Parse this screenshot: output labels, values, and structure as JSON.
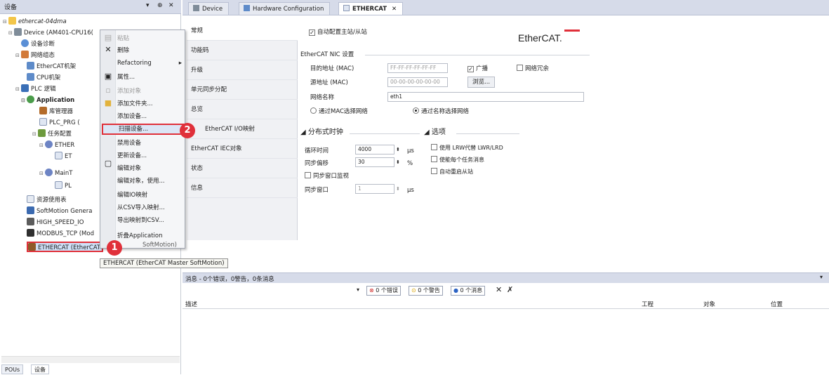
{
  "device_pane": {
    "title": "设备",
    "title_buttons": [
      "▾",
      "⊕",
      "✕"
    ],
    "tree": [
      {
        "label": "ethercat-04dma",
        "icon": "project-icon"
      },
      {
        "label": "Device (AM401-CPU16(",
        "icon": "device-icon"
      },
      {
        "label": "设备诊断",
        "icon": "diagnostics-icon"
      },
      {
        "label": "网络组态",
        "icon": "network-icon"
      },
      {
        "label": "EtherCAT机架",
        "icon": "rack-icon"
      },
      {
        "label": "CPU机架",
        "icon": "rack-icon"
      },
      {
        "label": "PLC 逻辑",
        "icon": "plc-icon"
      },
      {
        "label": "Application",
        "icon": "application-icon"
      },
      {
        "label": "库管理器",
        "icon": "library-icon"
      },
      {
        "label": "PLC_PRG (",
        "icon": "program-icon"
      },
      {
        "label": "任务配置",
        "icon": "task-icon"
      },
      {
        "label": "ETHER",
        "icon": "task-icon"
      },
      {
        "label": "ET",
        "icon": "program-icon"
      },
      {
        "label": "MainT",
        "icon": "task-icon"
      },
      {
        "label": "PL",
        "icon": "program-icon"
      },
      {
        "label": "资源使用表",
        "icon": "resource-icon"
      },
      {
        "label": "SoftMotion Genera",
        "icon": "softmotion-icon"
      },
      {
        "label": "HIGH_SPEED_IO",
        "icon": "io-icon"
      },
      {
        "label": "MODBUS_TCP (Mod",
        "icon": "modbus-icon"
      },
      {
        "label": "ETHERCAT (EtherCAT",
        "icon": "ethercat-icon"
      }
    ],
    "bottom_tabs": [
      "POUs",
      "设备"
    ]
  },
  "context_menu": {
    "items": [
      {
        "label": "粘贴",
        "disabled": true
      },
      {
        "label": "删除",
        "disabled": false
      },
      {
        "label": "Refactoring",
        "disabled": false,
        "submenu": "▸"
      },
      {
        "label": "属性...",
        "disabled": false
      },
      {
        "label": "添加对象",
        "disabled": true
      },
      {
        "label": "添加文件夹...",
        "disabled": false
      },
      {
        "label": "添加设备...",
        "disabled": false
      },
      {
        "label": "扫描设备...",
        "disabled": false
      },
      {
        "label": "禁用设备",
        "disabled": false
      },
      {
        "label": "更新设备...",
        "disabled": false
      },
      {
        "label": "编辑对象",
        "disabled": false
      },
      {
        "label": "编辑对象，使用...",
        "disabled": false
      },
      {
        "label": "编辑IO映射",
        "disabled": false
      },
      {
        "label": "从CSV导入映射...",
        "disabled": false
      },
      {
        "label": "导出映射到CSV...",
        "disabled": false
      },
      {
        "label": "折叠Application",
        "disabled": false
      }
    ],
    "tail_text": "SoftMotion)",
    "tooltip": "ETHERCAT (EtherCAT Master SoftMotion)"
  },
  "badges": [
    "1",
    "2"
  ],
  "editor_tabs": [
    {
      "label": "Device",
      "icon": "device-icon"
    },
    {
      "label": "Hardware Configuration",
      "icon": "hardware-icon"
    },
    {
      "label": "ETHERCAT",
      "icon": "ethercat-icon",
      "close": "✕"
    }
  ],
  "config_nav": [
    "常规",
    "功能码",
    "升级",
    "单元同步分配",
    "总览",
    "EtherCAT I/O映射",
    "EtherCAT IEC对象",
    "状态",
    "信息"
  ],
  "general": {
    "auto_config": "自动配置主站/从站",
    "logo_text": "EtherCAT.",
    "nic_section": "EtherCAT NIC 设置",
    "dest_addr_label": "目的地址 (MAC)",
    "dest_addr_value": "FF-FF-FF-FF-FF-FF",
    "broadcast": "广播",
    "redundancy": "冗余",
    "redundancy_prefix": "网络",
    "src_addr_label": "源地址 (MAC)",
    "src_addr_value": "00-00-00-00-00-00",
    "browse": "浏览...",
    "net_name_label": "网络名称",
    "net_name_value": "eth1",
    "select_by_mac": "通过MAC选择网络",
    "select_by_name": "通过名称选择网络",
    "dc_section": "分布式时钟",
    "options_section": "选项",
    "cycle_label": "循环时间",
    "cycle_value": "4000",
    "cycle_unit": "μs",
    "sync_offset_label": "同步偏移",
    "sync_offset_value": "30",
    "sync_offset_unit": "%",
    "sync_window_monitor": "同步窗口监视",
    "sync_window_label": "同步窗口",
    "sync_window_value": "1",
    "sync_window_unit": "μs",
    "opt_lrw": "使用 LRW代替 LWR/LRD",
    "opt_task_msg": "使能每个任务消息",
    "opt_autorestart": "自动重启从站"
  },
  "messages": {
    "header": "消息 - 0个错误，0警告，0条消息",
    "errors": "0 个错误",
    "warnings": "0 个警告",
    "infos": "0 个消息",
    "columns": [
      "描述",
      "工程",
      "对象",
      "位置"
    ]
  },
  "colors": {
    "badge": "#e0303a",
    "selection_border": "#e0303a"
  }
}
